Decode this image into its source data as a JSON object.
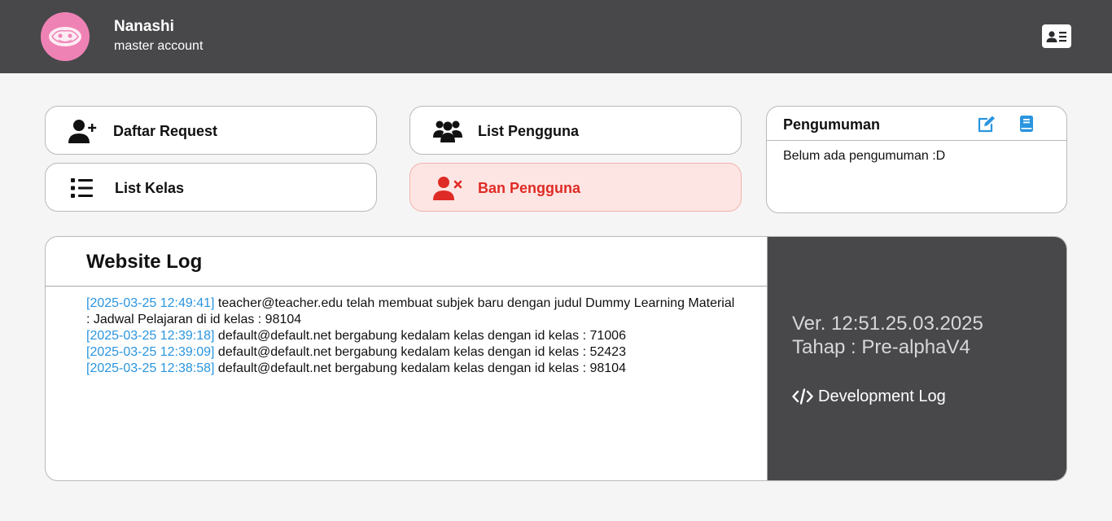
{
  "header": {
    "user_name": "Nanashi",
    "user_role": "master account",
    "avatar_color": "#ef82b5",
    "profile_card_icon": "id-card-icon"
  },
  "menu": {
    "daftar_request": {
      "label": "Daftar Request",
      "icon": "user-plus-icon"
    },
    "list_pengguna": {
      "label": "List Pengguna",
      "icon": "users-icon"
    },
    "list_kelas": {
      "label": "List Kelas",
      "icon": "list-icon"
    },
    "ban_pengguna": {
      "label": "Ban Pengguna",
      "icon": "user-xmark-icon",
      "color": "#df2b25"
    }
  },
  "announcement": {
    "title": "Pengumuman",
    "body": "Belum ada pengumuman :D",
    "edit_icon": "edit-icon",
    "book_icon": "book-icon",
    "icon_color": "#2a95df"
  },
  "website_log": {
    "title": "Website Log",
    "time_color": "#2a95df",
    "entries": [
      {
        "time": "[2025-03-25 12:49:41]",
        "text": "teacher@teacher.edu telah membuat subjek baru dengan judul Dummy Learning Material : Jadwal Pelajaran di id kelas : 98104"
      },
      {
        "time": "[2025-03-25 12:39:18]",
        "text": "default@default.net bergabung kedalam kelas dengan id kelas : 71006"
      },
      {
        "time": "[2025-03-25 12:39:09]",
        "text": "default@default.net bergabung kedalam kelas dengan id kelas : 52423"
      },
      {
        "time": "[2025-03-25 12:38:58]",
        "text": "default@default.net bergabung kedalam kelas dengan id kelas : 98104"
      }
    ]
  },
  "version_info": {
    "version": "Ver. 12:51.25.03.2025",
    "stage": "Tahap : Pre-alphaV4",
    "dev_log_label": "Development Log",
    "dev_log_icon": "code-icon"
  }
}
